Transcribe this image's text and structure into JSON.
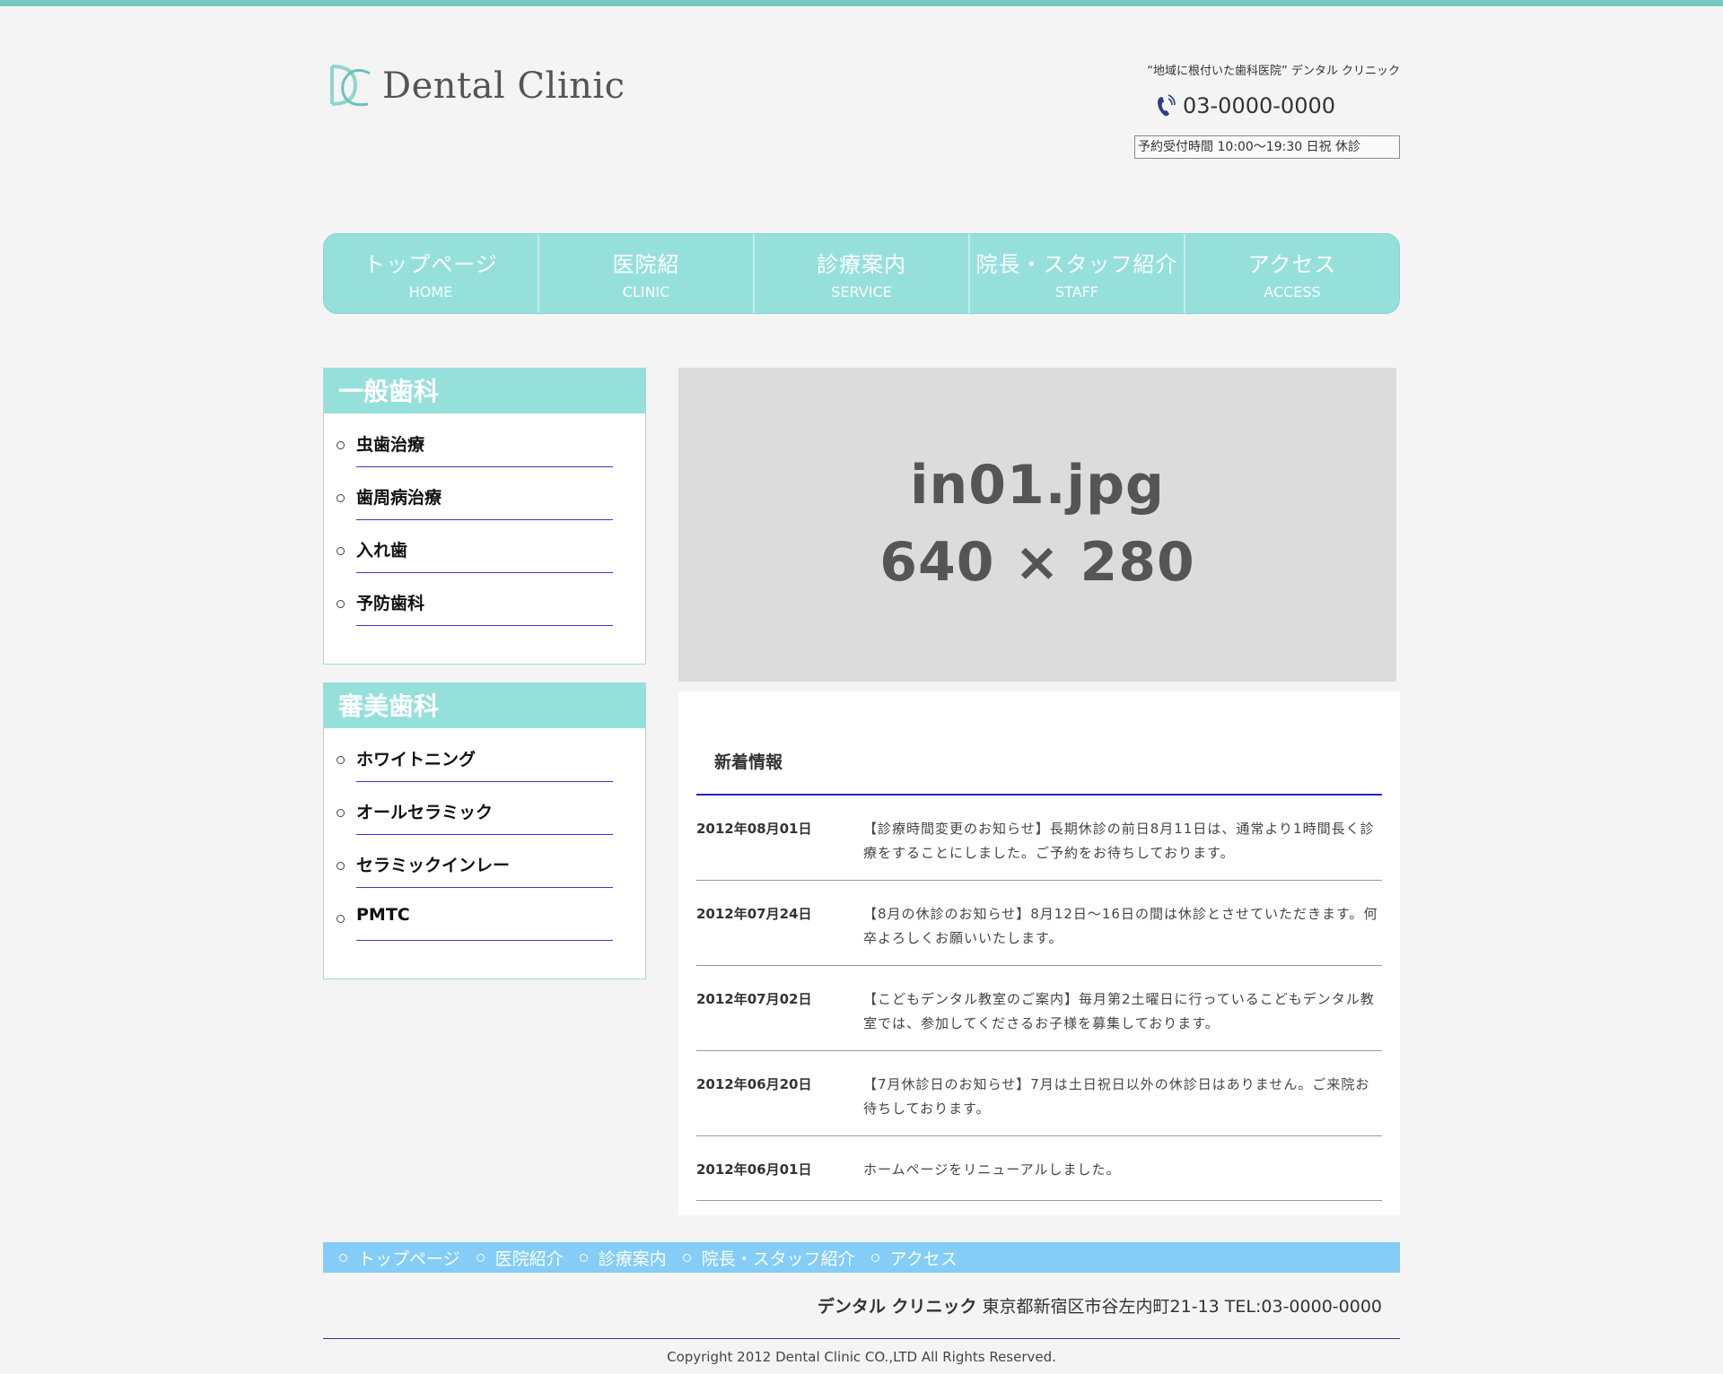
{
  "header": {
    "logo_text": "Dental Clinic",
    "tagline": "“地域に根付いた歯科医院” デンタル クリニック",
    "phone": "03-0000-0000",
    "hours": "予約受付時間 10:00〜19:30 日祝 休診"
  },
  "nav": [
    {
      "jp": "トップページ",
      "en": "HOME"
    },
    {
      "jp": "医院紹",
      "en": "CLINIC"
    },
    {
      "jp": "診療案内",
      "en": "SERVICE"
    },
    {
      "jp": "院長・スタッフ紹介",
      "en": "STAFF"
    },
    {
      "jp": "アクセス",
      "en": "ACCESS"
    }
  ],
  "sidebar": [
    {
      "title": "一般歯科",
      "items": [
        "虫歯治療",
        "歯周病治療",
        "入れ歯",
        "予防歯科"
      ]
    },
    {
      "title": "審美歯科",
      "items": [
        "ホワイトニング",
        "オールセラミック",
        "セラミックインレー",
        "PMTC"
      ]
    }
  ],
  "hero": {
    "name": "in01.jpg",
    "size": "640 × 280"
  },
  "news": {
    "title": "新着情報",
    "items": [
      {
        "date": "2012年08月01日",
        "text": "【診療時間変更のお知らせ】長期休診の前日8月11日は、通常より1時間長く診療をすることにしました。ご予約をお待ちしております。"
      },
      {
        "date": "2012年07月24日",
        "text": "【8月の休診のお知らせ】8月12日〜16日の間は休診とさせていただきます。何卒よろしくお願いいたします。"
      },
      {
        "date": "2012年07月02日",
        "text": "【こどもデンタル教室のご案内】毎月第2土曜日に行っているこどもデンタル教室では、参加してくださるお子様を募集しております。"
      },
      {
        "date": "2012年06月20日",
        "text": "【7月休診日のお知らせ】7月は土日祝日以外の休診日はありません。ご来院お待ちしております。"
      },
      {
        "date": "2012年06月01日",
        "text": "ホームページをリニューアルしました。"
      }
    ]
  },
  "footer": {
    "links": [
      "トップページ",
      "医院紹介",
      "診療案内",
      "院長・スタッフ紹介",
      "アクセス"
    ],
    "clinic_name": "デンタル クリニック",
    "address": "東京都新宿区市谷左内町21-13 TEL:03-0000-0000",
    "copyright": "Copyright 2012 Dental Clinic CO.,LTD All Rights Reserved."
  },
  "colors": {
    "accent": "#96e0dc",
    "rule": "#2522c9",
    "footer_nav": "#83cdf6"
  },
  "icons": {
    "phone": "phone-icon",
    "logo": "dc-logo-icon"
  }
}
